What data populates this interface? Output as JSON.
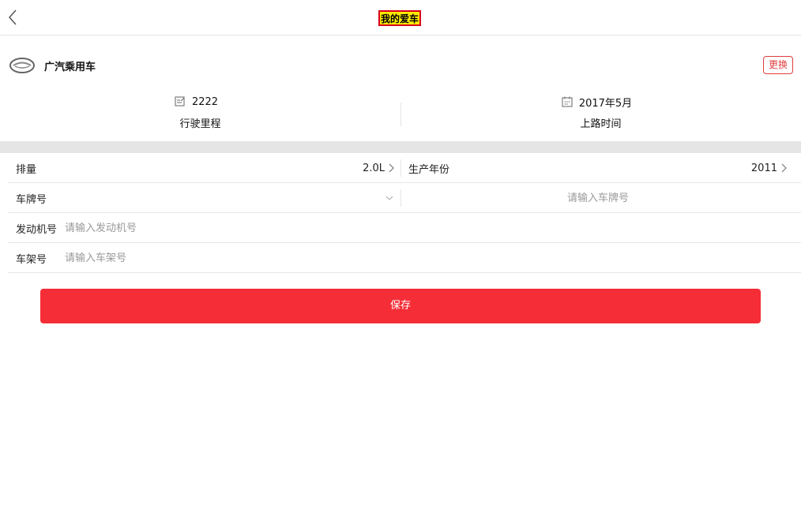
{
  "header": {
    "title": "我的爱车",
    "back_icon": "chevron-left-icon"
  },
  "car": {
    "brand_name": "广汽乘用车",
    "change_label": "更换",
    "brand_logo_icon": "gac-logo-icon"
  },
  "stats": {
    "mileage_value": "2222",
    "mileage_label": "行驶里程",
    "mileage_icon": "edit-note-icon",
    "date_value": "2017年5月",
    "date_label": "上路时间",
    "date_icon": "calendar-icon"
  },
  "form": {
    "displacement_label": "排量",
    "displacement_value": "2.0L",
    "year_label": "生产年份",
    "year_value": "2011",
    "plate_label": "车牌号",
    "plate_placeholder": "请输入车牌号",
    "engine_label": "发动机号",
    "engine_placeholder": "请输入发动机号",
    "frame_label": "车架号",
    "frame_placeholder": "请输入车架号"
  },
  "actions": {
    "save_label": "保存"
  },
  "colors": {
    "accent": "#f42d37",
    "title_highlight": "#ffeb00",
    "title_border": "#d9001b"
  }
}
